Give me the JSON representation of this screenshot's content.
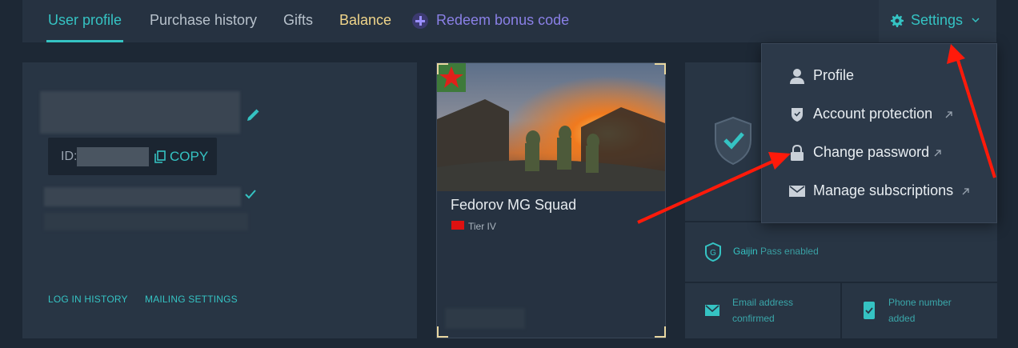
{
  "nav": {
    "tabs": [
      {
        "label": "User profile"
      },
      {
        "label": "Purchase history"
      },
      {
        "label": "Gifts"
      },
      {
        "label": "Balance"
      },
      {
        "label": "Redeem bonus code"
      }
    ],
    "settings_label": "Settings"
  },
  "profile": {
    "id_label": "ID:",
    "copy_label": "COPY",
    "links": [
      "LOG IN HISTORY",
      "MAILING SETTINGS"
    ]
  },
  "card": {
    "title": "Fedorov MG Squad",
    "tier": "Tier IV"
  },
  "security": {
    "gaijin_pass_prefix": "Gaijin",
    "gaijin_pass_suffix": "Pass enabled",
    "email_status": [
      "Email address",
      "confirmed"
    ],
    "phone_status": [
      "Phone number",
      "added"
    ]
  },
  "settings_menu": {
    "items": [
      {
        "label": "Profile",
        "icon": "user-icon"
      },
      {
        "label": "Account protection",
        "icon": "shield-icon"
      },
      {
        "label": "Change password",
        "icon": "lock-icon"
      },
      {
        "label": "Manage subscriptions",
        "icon": "mail-icon"
      }
    ]
  },
  "colors": {
    "accent": "#35c3c3",
    "balance": "#f0d58a",
    "redeem": "#8a80e6",
    "annotation_arrow": "#ff1a0a"
  }
}
